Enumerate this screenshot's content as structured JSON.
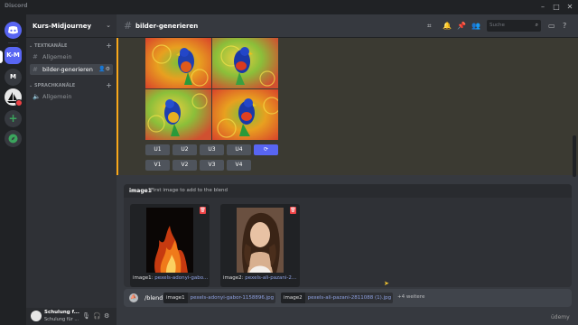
{
  "window": {
    "app_name": "Discord",
    "controls": [
      "minimize-icon",
      "maximize-icon",
      "close-icon"
    ]
  },
  "servers": [
    {
      "id": "home",
      "label": "discord-logo-icon"
    },
    {
      "id": "kurs",
      "label": "K-M"
    },
    {
      "id": "m",
      "label": "M"
    },
    {
      "id": "midjourney",
      "label": ""
    },
    {
      "id": "add",
      "label": "+"
    },
    {
      "id": "explore",
      "label": "compass-icon"
    }
  ],
  "sidebar": {
    "server_name": "Kurs-Midjourney",
    "text_category": "TEXTKANÄLE",
    "voice_category": "SPRACHKANÄLE",
    "text_channels": [
      {
        "label": "Allgemein"
      },
      {
        "label": "bilder-generieren"
      }
    ],
    "voice_channels": [
      {
        "label": "Allgemein"
      }
    ]
  },
  "user": {
    "name": "Schulung f...",
    "status": "Schulung für ..."
  },
  "header": {
    "channel": "bilder-generieren",
    "search_placeholder": "Suche"
  },
  "messages": {
    "upscale_buttons": [
      "U1",
      "U2",
      "U3",
      "U4"
    ],
    "variation_buttons": [
      "V1",
      "V2",
      "V3",
      "V4"
    ],
    "reroll_icon": "refresh-icon"
  },
  "options_panel": {
    "option_name": "image1",
    "option_desc": "First image to add to the blend",
    "attachments": [
      {
        "label": "image1",
        "file": "pexels-adonyi-gabo..."
      },
      {
        "label": "image2",
        "file": "pexels-ali-pazani-2..."
      }
    ]
  },
  "command_bar": {
    "command": "/blend",
    "params": [
      {
        "key": "image1",
        "value": "pexels-adonyi-gabor-1158896.jpg"
      },
      {
        "key": "image2",
        "value": "pexels-ali-pazani-2811088 (1).jpg"
      }
    ],
    "more": "+4 weitere"
  },
  "watermark": "üdemy",
  "colors": {
    "accent": "#5865f2",
    "highlight": "#faa81a",
    "danger": "#ed4245",
    "online": "#3ba55d"
  }
}
